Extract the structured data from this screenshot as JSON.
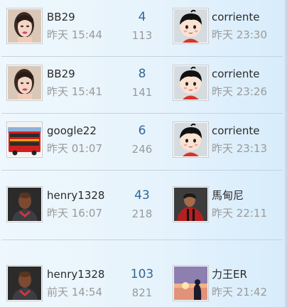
{
  "threads": [
    {
      "author": {
        "name": "BB29",
        "time": "昨天 15:44",
        "avatar_icon": "woman-portrait-icon"
      },
      "replies": "4",
      "views": "113",
      "last_poster": {
        "name": "corriente",
        "time": "昨天 23:30",
        "avatar_icon": "cartoon-boy-avatar-icon"
      }
    },
    {
      "author": {
        "name": "BB29",
        "time": "昨天 15:41",
        "avatar_icon": "woman-portrait-icon"
      },
      "replies": "8",
      "views": "141",
      "last_poster": {
        "name": "corriente",
        "time": "昨天 23:26",
        "avatar_icon": "cartoon-boy-avatar-icon"
      }
    },
    {
      "author": {
        "name": "google22",
        "time": "昨天 01:07",
        "avatar_icon": "red-bus-avatar-icon"
      },
      "replies": "6",
      "views": "246",
      "last_poster": {
        "name": "corriente",
        "time": "昨天 23:13",
        "avatar_icon": "cartoon-boy-avatar-icon"
      }
    },
    {
      "author": {
        "name": "henry1328",
        "time": "昨天 16:07",
        "avatar_icon": "footballer-portrait-icon"
      },
      "replies": "43",
      "views": "218",
      "last_poster": {
        "name": "馬甸尼",
        "time": "昨天 22:11",
        "avatar_icon": "footballer-red-jersey-icon"
      }
    },
    {
      "author": {
        "name": "henry1328",
        "time": "前天 14:54",
        "avatar_icon": "footballer-portrait-icon"
      },
      "replies": "103",
      "views": "821",
      "last_poster": {
        "name": "力王ER",
        "time": "昨天 21:42",
        "avatar_icon": "sunset-silhouette-avatar-icon"
      }
    }
  ],
  "colors": {
    "reply_count": "#336699",
    "muted_text": "#9a9a9a",
    "name_text": "#2b2b2b",
    "divider": "#c4d3df"
  }
}
